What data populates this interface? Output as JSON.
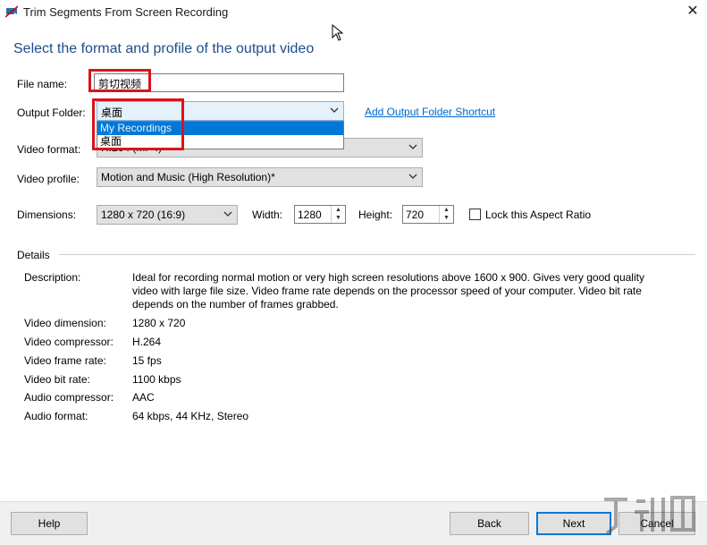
{
  "window": {
    "title": "Trim Segments From Screen Recording"
  },
  "heading": "Select the format and profile of the output video",
  "form": {
    "file_name_label": "File name:",
    "file_name_value": "剪切视频",
    "output_folder_label": "Output Folder:",
    "output_folder_value": "桌面",
    "output_folder_options": [
      "My Recordings",
      "桌面"
    ],
    "add_shortcut_link": "Add Output Folder Shortcut",
    "video_format_label": "Video format:",
    "video_format_value": "H.264 (MP4)",
    "video_profile_label": "Video profile:",
    "video_profile_value": "Motion and Music (High Resolution)*",
    "dimensions_label": "Dimensions:",
    "dimensions_value": "1280 x 720 (16:9)",
    "width_label": "Width:",
    "width_value": "1280",
    "height_label": "Height:",
    "height_value": "720",
    "lock_aspect_label": "Lock this Aspect Ratio"
  },
  "details": {
    "section_label": "Details",
    "rows": [
      {
        "label": "Description:",
        "value": "Ideal for recording normal motion or very high screen resolutions above 1600 x 900.   Gives very good quality video with large file size. Video frame rate depends on the processor speed of your computer. Video bit rate depends on the number of frames grabbed."
      },
      {
        "label": "Video dimension:",
        "value": "1280 x 720"
      },
      {
        "label": "Video compressor:",
        "value": "H.264"
      },
      {
        "label": "Video frame rate:",
        "value": "15 fps"
      },
      {
        "label": "Video bit rate:",
        "value": "1100 kbps"
      },
      {
        "label": "Audio compressor:",
        "value": "AAC"
      },
      {
        "label": "Audio format:",
        "value": "64 kbps, 44 KHz, Stereo"
      }
    ]
  },
  "footer": {
    "help": "Help",
    "back": "Back",
    "next": "Next",
    "cancel": "Cancel"
  },
  "colors": {
    "heading": "#1e4e8c",
    "link": "#0066cc",
    "highlight_box": "#d9141c",
    "selection": "#0078d7"
  }
}
